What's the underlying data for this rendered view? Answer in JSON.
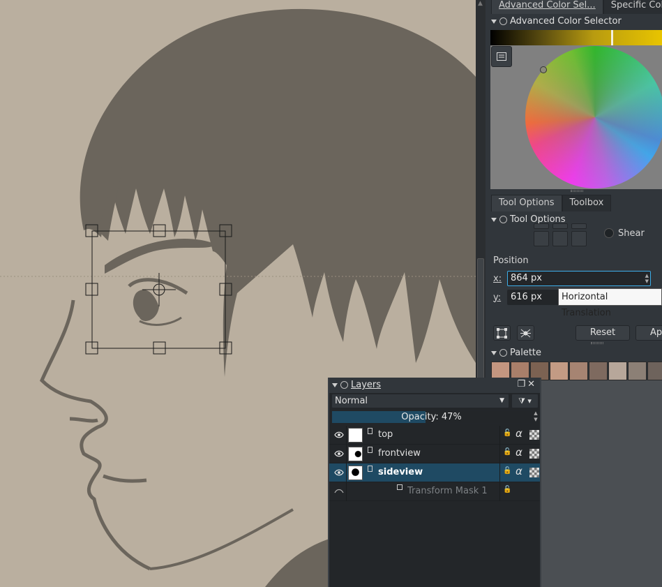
{
  "dock_tabs": {
    "top": [
      "Advanced Color Sel...",
      "Specific Colo"
    ],
    "middle": [
      "Tool Options",
      "Toolbox"
    ]
  },
  "color_selector": {
    "title": "Advanced Color Selector"
  },
  "tool_options": {
    "title": "Tool Options",
    "shear_label": "Shear",
    "position_label": "Position",
    "x_label": "x:",
    "x_value": "864 px",
    "y_label": "y:",
    "y_value": "616 px",
    "tooltip": "Horizontal Translation",
    "reset_label": "Reset",
    "apply_label": "Ap"
  },
  "palette": {
    "title": "Palette",
    "colors": [
      "#c49680",
      "#a97f6a",
      "#7c6252",
      "#c39b84",
      "#a68472",
      "#7e6a5f",
      "#b7a79a",
      "#8c8076",
      "#6e635c",
      "#5c5f58",
      "#4a4d46"
    ]
  },
  "layers": {
    "title": "Layers",
    "blend_mode": "Normal",
    "opacity_text": "Opacity:  47%",
    "opacity_value": 0.47,
    "items": [
      {
        "name": "top",
        "selected": false
      },
      {
        "name": "frontview",
        "selected": false
      },
      {
        "name": "sideview",
        "selected": true
      },
      {
        "name": "Transform Mask 1",
        "selected": false
      }
    ]
  },
  "colors": {
    "canvas": "#baaf9f",
    "sketch": "#6b655c",
    "accent": "#3daee9",
    "selection": "#1f4a63"
  }
}
